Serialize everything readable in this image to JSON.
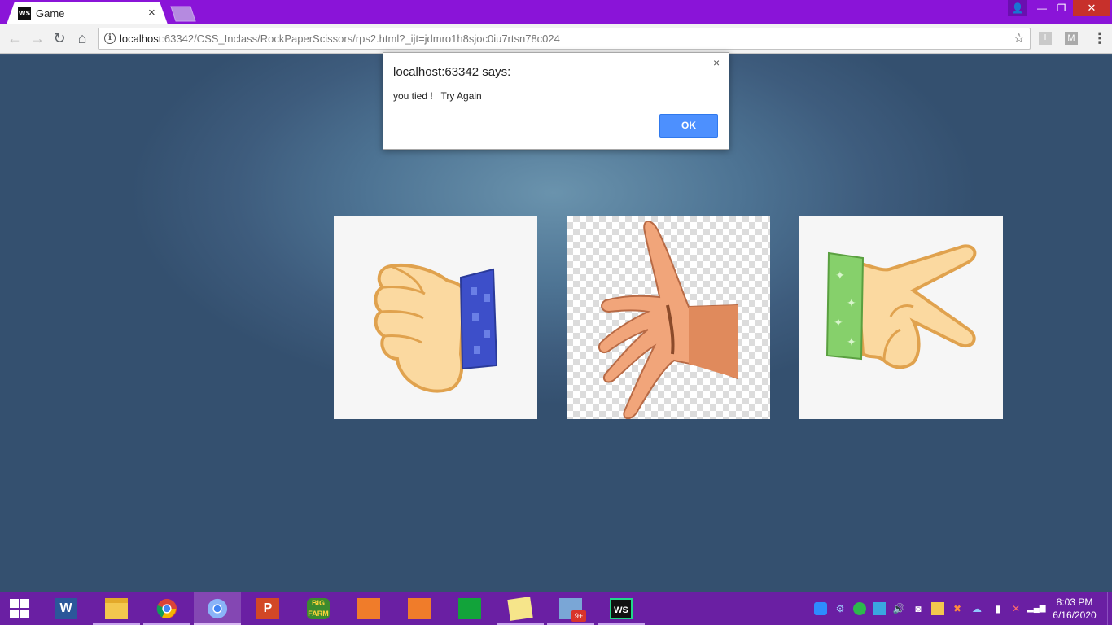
{
  "browser": {
    "tab_title": "Game",
    "tab_icon_text": "WS",
    "tab_close": "×",
    "url_host": "localhost",
    "url_rest": ":63342/CSS_Inclass/RockPaperScissors/rps2.html?_ijt=jdmro1h8sjoc0iu7rtsn78c024",
    "extensions": [
      "I",
      "M"
    ],
    "window_buttons": {
      "minimize": "—",
      "restore": "❐",
      "close": "✕",
      "user": "👤"
    },
    "nav": {
      "back": "←",
      "forward": "→",
      "reload": "↻",
      "home": "⌂",
      "menu": "⋮",
      "star": "☆",
      "info": "i"
    }
  },
  "dialog": {
    "title": "localhost:63342 says:",
    "message": "you tied !   Try Again",
    "ok_label": "OK",
    "close": "×"
  },
  "choices": [
    {
      "name": "rock",
      "sleeve_color": "#3d4fc9"
    },
    {
      "name": "paper",
      "sleeve_color": "#e8a070"
    },
    {
      "name": "scissors",
      "sleeve_color": "#86d06b"
    }
  ],
  "taskbar": {
    "apps": [
      "word",
      "file-explorer",
      "chrome",
      "chrome-profile",
      "powerpoint",
      "big-farm",
      "screen-recorder",
      "camera-app",
      "store",
      "sticky-notes",
      "task-manager",
      "webstorm"
    ],
    "task_badge": "9+",
    "clock_time": "8:03 PM",
    "clock_date": "6/16/2020"
  },
  "colors": {
    "titlebar": "#8a14d8",
    "taskbar": "#6a1fa3",
    "ok_button": "#4d90fe"
  }
}
